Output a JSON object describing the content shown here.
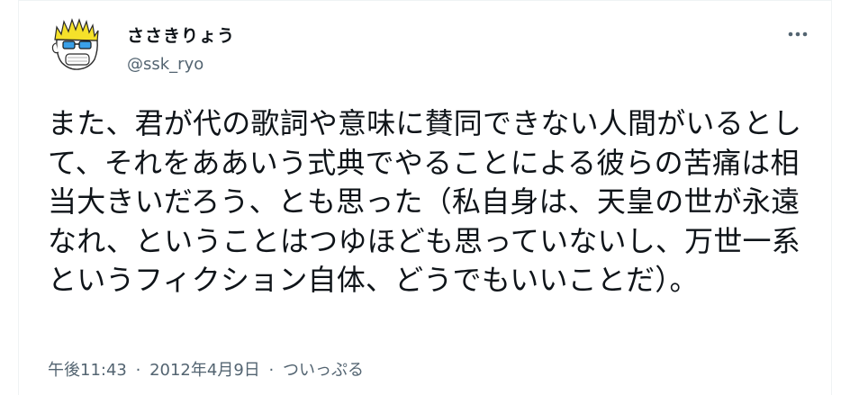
{
  "tweet": {
    "display_name": "ささきりょう",
    "handle": "@ssk_ryo",
    "more_icon": "more-horizontal-icon",
    "avatar_icon": "cartoon-face-avatar",
    "text": "また、君が代の歌詞や意味に賛同できない人間がいるとして、それをああいう式典でやることによる彼らの苦痛は相当大きいだろう、とも思った（私自身は、天皇の世が永遠なれ、ということはつゆほども思っていないし、万世一系というフィクション自体、どうでもいいことだ）。",
    "time": "午後11:43",
    "separator": "·",
    "date": "2012年4月9日",
    "source": "ついっぷる"
  },
  "colors": {
    "text": "#0f1419",
    "secondary": "#536471",
    "avatar_hair": "#f5e12a",
    "avatar_glasses": "#3aa0e8"
  }
}
